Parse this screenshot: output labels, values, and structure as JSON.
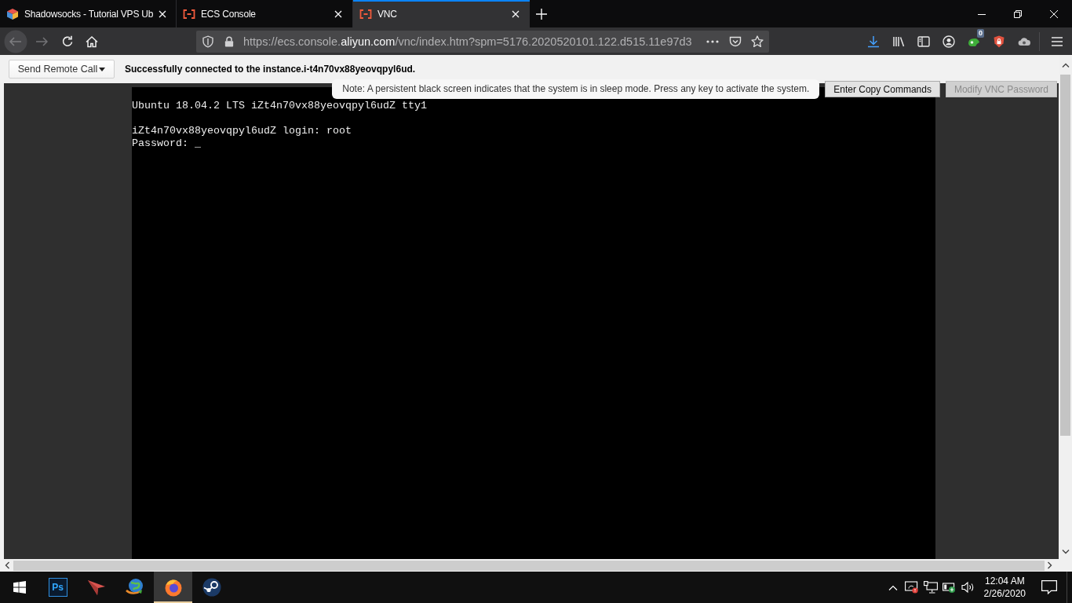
{
  "browser": {
    "tabs": [
      {
        "title": "Shadowsocks - Tutorial VPS Ub",
        "kind": "cube",
        "selected": false
      },
      {
        "title": "ECS Console",
        "kind": "bracket",
        "selected": false
      },
      {
        "title": "VNC",
        "kind": "bracket",
        "selected": true
      }
    ],
    "address_bar": {
      "url": {
        "prefix": "https://ecs.console.",
        "domain": "aliyun.com",
        "path": "/vnc/index.htm?spm=5176.2020520101.122.d515.11e97d3"
      }
    },
    "extension_badge": "0"
  },
  "page": {
    "toolbar": {
      "menu_button": "Send Remote Call",
      "status": "Successfully connected to the instance.i-t4n70vx88yeovqpyl6ud."
    },
    "note": "Note: A persistent black screen indicates that the system is in sleep mode. Press any key to activate the system.",
    "buttons": [
      {
        "label": "Enter Copy Commands",
        "disabled": false
      },
      {
        "label": "Modify VNC Password",
        "disabled": true
      }
    ],
    "terminal": {
      "blocks": [
        {
          "lines": [
            "Ubuntu 18.04.2 LTS iZt4n70vx88yeovqpyl6udZ tty1"
          ]
        },
        {
          "lines": [
            "iZt4n70vx88yeovqpyl6udZ login: root",
            "Password: _"
          ]
        }
      ]
    }
  },
  "taskbar": {
    "apps": [
      {
        "kind": "start",
        "selected": false
      },
      {
        "kind": "photoshop",
        "label": "Ps",
        "selected": false
      },
      {
        "kind": "paper-plane",
        "selected": false
      },
      {
        "kind": "globe",
        "selected": false
      },
      {
        "kind": "firefox",
        "selected": true
      },
      {
        "kind": "steam",
        "selected": false
      }
    ],
    "clock": {
      "time": "12:04 AM",
      "date": "2/26/2020"
    }
  }
}
